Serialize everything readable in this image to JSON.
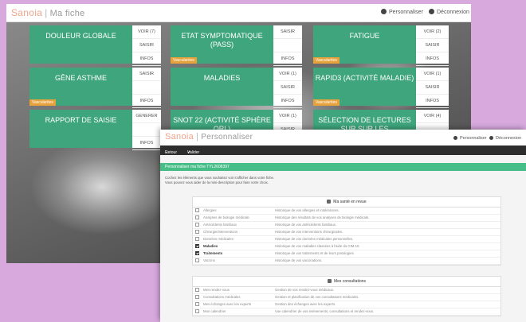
{
  "back_window": {
    "brand": "Sanoia",
    "title": "Ma fiche",
    "header_actions": [
      {
        "label": "Personnaliser",
        "icon": "gear-icon"
      },
      {
        "label": "Déconnexion",
        "icon": "power-icon"
      }
    ],
    "tiles": [
      {
        "title": "DOULEUR GLOBALE",
        "actions": [
          "VOIR (7)",
          "SAISIR",
          "INFOS"
        ],
        "tag": ""
      },
      {
        "title": "ETAT SYMPTOMATIQUE (PASS)",
        "actions": [
          "SAISIR",
          "",
          "INFOS"
        ],
        "tag": "Vascularites"
      },
      {
        "title": "FATIGUE",
        "actions": [
          "VOIR (2)",
          "SAISIR",
          "INFOS"
        ],
        "tag": "Vascularites"
      },
      {
        "title": "GÊNE ASTHME",
        "actions": [
          "SAISIR",
          "",
          "INFOS"
        ],
        "tag": "Vascularites"
      },
      {
        "title": "MALADIES",
        "actions": [
          "VOIR (1)",
          "SAISIR",
          "INFOS"
        ],
        "tag": ""
      },
      {
        "title": "RAPID3 (ACTIVITÉ MALADIE)",
        "actions": [
          "VOIR (1)",
          "SAISIR",
          "INFOS"
        ],
        "tag": "Vascularites"
      },
      {
        "title": "RAPPORT DE SAISIE",
        "actions": [
          "GENERER",
          "",
          "INFOS"
        ],
        "tag": ""
      },
      {
        "title": "SNOT 22 (ACTIVITÉ SPHÈRE ORL)",
        "actions": [
          "VOIR (1)",
          "SAISIR",
          ""
        ],
        "tag": ""
      },
      {
        "title": "SÉLECTION DE LECTURES SUR SUR LES VASCULARITES",
        "actions": [
          "VOIR (4)",
          "",
          ""
        ],
        "tag": ""
      }
    ]
  },
  "front_window": {
    "brand": "Sanoia",
    "title": "Personnaliser",
    "header_actions": [
      {
        "label": "Personnaliser",
        "icon": "gear-icon"
      },
      {
        "label": "Déconnexion",
        "icon": "power-icon"
      }
    ],
    "toolbar": {
      "back": "Retour",
      "validate": "Valider"
    },
    "banner": "Personnaliser ma fiche TYL2608397",
    "intro": [
      "Cochez les éléments que vous souhaitez voir s'afficher dans votre fiche.",
      "Vous pouvez vous aider de la mini-description pour faire votre choix."
    ],
    "panels": [
      {
        "heading": "Ma santé en revue",
        "icon": "heart-icon",
        "rows": [
          {
            "name": "Allergies",
            "desc": "Historique de vos allergies et intolérances.",
            "checked": false
          },
          {
            "name": "Analyses de biologie médicale",
            "desc": "Historique des résultats de vos analyses de biologie médicale.",
            "checked": false
          },
          {
            "name": "Antécédents familiaux",
            "desc": "Historique de vos antécédents familiaux.",
            "checked": false
          },
          {
            "name": "Chirurgie/interventions",
            "desc": "Historique de vos interventions chirurgicales.",
            "checked": false
          },
          {
            "name": "Données médicales",
            "desc": "Historique de vos données médicales personnelles.",
            "checked": false
          },
          {
            "name": "Maladies",
            "desc": "Historique de vos maladies classées à l'aide du CIM-10.",
            "checked": true
          },
          {
            "name": "Traitements",
            "desc": "Historique de vos traitements et de leurs posologies.",
            "checked": true
          },
          {
            "name": "Vaccins",
            "desc": "Historique de vos vaccinations.",
            "checked": false
          }
        ]
      },
      {
        "heading": "Mes consultations",
        "icon": "stethoscope-icon",
        "rows": [
          {
            "name": "Mes rendez-vous",
            "desc": "Gestion de vos rendez-vous médicaux.",
            "checked": false
          },
          {
            "name": "Consultations médicales",
            "desc": "Gestion et planification de vos consultations médicales.",
            "checked": false
          },
          {
            "name": "Mes échanges avec les experts",
            "desc": "Gestion des échanges avec les experts.",
            "checked": false
          },
          {
            "name": "Mon calendrier",
            "desc": "Vue calendrier de vos événements, consultations et rendez-vous.",
            "checked": false
          }
        ]
      }
    ]
  }
}
